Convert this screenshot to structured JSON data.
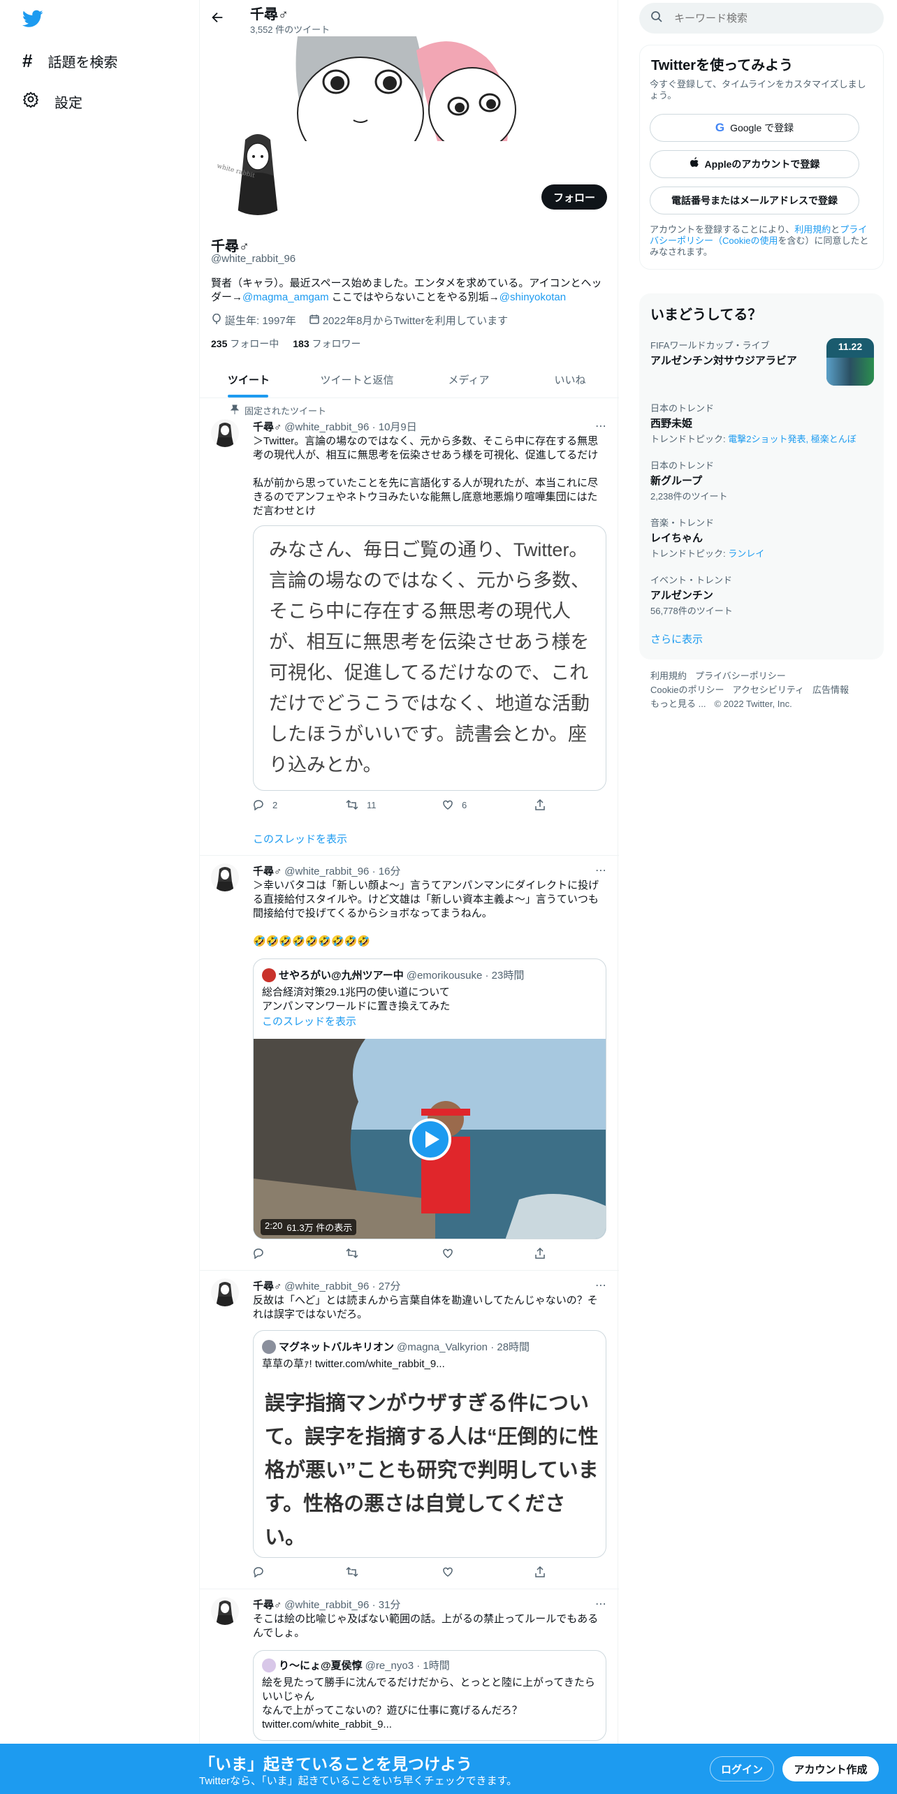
{
  "nav": {
    "explore_label": "話題を検索",
    "settings_label": "設定"
  },
  "header": {
    "name": "千尋♂",
    "tweet_count": "3,552 件のツイート"
  },
  "profile": {
    "name": "千尋♂",
    "handle": "@white_rabbit_96",
    "follow_label": "フォロー",
    "bio_text": "賢者（キャラ）。最近スペース始めました。エンタメを求めている。アイコンとヘッダー→",
    "bio_link1": "@magma_amgam",
    "bio_mid": " ここではやらないことをやる別垢→",
    "bio_link2": "@shinyokotan",
    "birth": "誕生年: 1997年",
    "joined": "2022年8月からTwitterを利用しています",
    "following_count": "235",
    "following_label": "フォロー中",
    "followers_count": "183",
    "followers_label": "フォロワー",
    "avatar_caption": "white rabbit"
  },
  "tabs": [
    "ツイート",
    "ツイートと返信",
    "メディア",
    "いいね"
  ],
  "tweets": [
    {
      "pinned_label": "固定されたツイート",
      "name": "千尋♂",
      "meta": "@white_rabbit_96 · 10月9日",
      "text1": "＞Twitter。言論の場なのではなく、元から多数、そこら中に存在する無思考の現代人が、相互に無思考を伝染させあう様を可視化、促進してるだけ",
      "text2": "私が前から思っていたことを先に言語化する人が現れたが、本当これに尽きるのでアンフェやネトウヨみたいな能無し底意地悪煽り喧嘩集団にはただ言わせとけ",
      "image_text": "みなさん、毎日ご覧の通り、Twitter。言論の場なのではなく、元から多数、そこら中に存在する無思考の現代人が、相互に無思考を伝染させあう様を可視化、促進してるだけなので、これだけでどうこうではなく、地道な活動したほうがいいです。読書会とか。座り込みとか。",
      "replies": "2",
      "retweets": "11",
      "likes": "6",
      "thread_label": "このスレッドを表示"
    },
    {
      "name": "千尋♂",
      "meta": "@white_rabbit_96 · 16分",
      "text1": "＞幸いバタコは「新しい顔よ〜」言うてアンパンマンにダイレクトに投げる直接給付スタイルや。けど文雄は「新しい資本主義よ〜」言うていつも間接給付で投げてくるからショボなってまうねん。",
      "text2": "🤣🤣🤣🤣🤣🤣🤣🤣🤣",
      "quote_name": "せやろがい@九州ツアー中",
      "quote_meta": "@emorikousuke · 23時間",
      "quote_text1": "総合経済対策29.1兆円の使い道について",
      "quote_text2": "アンパンマンワールドに置き換えてみた",
      "quote_thread": "このスレッドを表示",
      "video_duration": "2:20",
      "video_views": "61.3万 件の表示"
    },
    {
      "name": "千尋♂",
      "meta": "@white_rabbit_96 · 27分",
      "text1": "反故は「へど」とは読まんから言葉自体を勘違いしてたんじゃないの？それは誤字ではないだろ。",
      "quote_name": "マグネットバルキリオン",
      "quote_meta": "@magna_Valkyrion · 28時間",
      "quote_text1": "草草の草ｧ!  twitter.com/white_rabbit_9...",
      "quote_big": "誤字指摘マンがウザすぎる件について。誤字を指摘する人は“圧倒的に性格が悪い”ことも研究で判明しています。性格の悪さは自覚してください。"
    },
    {
      "name": "千尋♂",
      "meta": "@white_rabbit_96 · 31分",
      "text1": "そこは絵の比喩じゃ及ばない範囲の話。上がるの禁止ってルールでもあるんでしょ。",
      "quote_name": "り〜にょ@夏侯惇",
      "quote_meta": "@re_nyo3 · 1時間",
      "quote_text1": "絵を見たって勝手に沈んでるだけだから、とっとと陸に上がってきたらいいじゃん",
      "quote_text2": "なんで上がってこないの？遊びに仕事に寛げるんだろ？",
      "quote_text3": "twitter.com/white_rabbit_9..."
    }
  ],
  "search": {
    "placeholder": "キーワード検索"
  },
  "signup": {
    "title": "Twitterを使ってみよう",
    "subtitle": "今すぐ登録して、タイムラインをカスタマイズしましょう。",
    "google_label": "Google で登録",
    "apple_label": "Appleのアカウントで登録",
    "phone_label": "電話番号またはメールアドレスで登録",
    "legal_1": "アカウントを登録することにより、",
    "legal_terms": "利用規約",
    "legal_2": "と",
    "legal_privacy": "プライバシーポリシー（Cookieの使用",
    "legal_3": "を含む）に同意したとみなされます。"
  },
  "trends": {
    "title": "いまどうしてる？",
    "items": [
      {
        "category": "FIFAワールドカップ・ライブ",
        "name": "アルゼンチン対サウジアラビア",
        "thumb_text": "11.22"
      },
      {
        "category": "日本のトレンド",
        "name": "西野未姫",
        "sub_prefix": "トレンドトピック: ",
        "sub_link": "電撃2ショット発表, 極楽とんぼ"
      },
      {
        "category": "日本のトレンド",
        "name": "新グループ",
        "sub": "2,238件のツイート"
      },
      {
        "category": "音楽・トレンド",
        "name": "レイちゃん",
        "sub_prefix": "トレンドトピック: ",
        "sub_link": "ランレイ"
      },
      {
        "category": "イベント・トレンド",
        "name": "アルゼンチン",
        "sub": "56,778件のツイート"
      }
    ],
    "show_more": "さらに表示"
  },
  "footer": {
    "line1": [
      "利用規約",
      "プライバシーポリシー"
    ],
    "line2": [
      "Cookieのポリシー",
      "アクセシビリティ",
      "広告情報"
    ],
    "more": "もっと見る ...",
    "copyright": "© 2022 Twitter, Inc."
  },
  "bottom_bar": {
    "title": "「いま」起きていることを見つけよう",
    "subtitle": "Twitterなら、「いま」起きていることをいち早くチェックできます。",
    "login_label": "ログイン",
    "signup_label": "アカウント作成"
  },
  "colors": {
    "accent": "#1d9bf0",
    "text": "#0f1419",
    "muted": "#536471"
  }
}
